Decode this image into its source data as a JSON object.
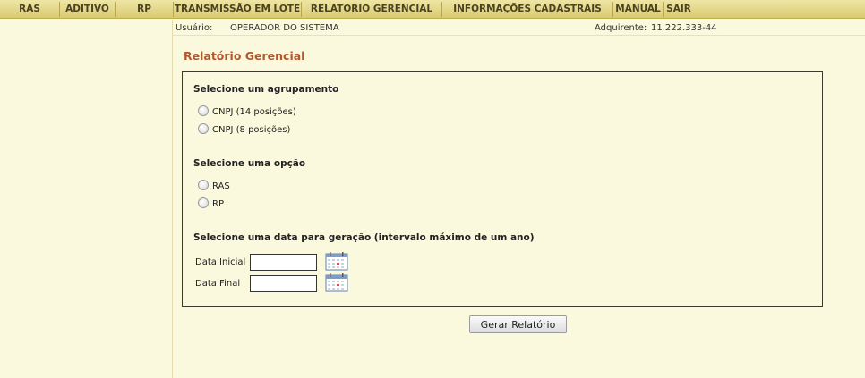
{
  "menu": {
    "items": [
      {
        "label": "RAS"
      },
      {
        "label": "ADITIVO"
      },
      {
        "label": "RP"
      },
      {
        "label": "TRANSMISSÃO EM LOTE"
      },
      {
        "label": "RELATORIO GERENCIAL"
      },
      {
        "label": "INFORMAÇÕES CADASTRAIS"
      },
      {
        "label": "MANUAL"
      },
      {
        "label": "SAIR"
      }
    ]
  },
  "info": {
    "user_label": "Usuário:",
    "user_value": "OPERADOR DO SISTEMA",
    "acquirer_label": "Adquirente:",
    "acquirer_value": "11.222.333-44"
  },
  "page": {
    "title": "Relatório Gerencial"
  },
  "grouping": {
    "title": "Selecione um agrupamento",
    "options": [
      {
        "label": "CNPJ (14 posições)",
        "checked": false
      },
      {
        "label": "CNPJ (8 posições)",
        "checked": false
      }
    ]
  },
  "option": {
    "title": "Selecione uma opção",
    "options": [
      {
        "label": "RAS",
        "checked": false
      },
      {
        "label": "RP",
        "checked": false
      }
    ]
  },
  "dates": {
    "title": "Selecione uma data para geração (intervalo máximo de um ano)",
    "start_label": "Data Inicial",
    "start_value": "",
    "end_label": "Data Final",
    "end_value": ""
  },
  "actions": {
    "generate_label": "Gerar Relatório"
  },
  "icons": {
    "calendar": "calendar-icon"
  },
  "colors": {
    "background": "#fbf9dd",
    "menu": "#d9cb6f",
    "title": "#b5562c"
  }
}
